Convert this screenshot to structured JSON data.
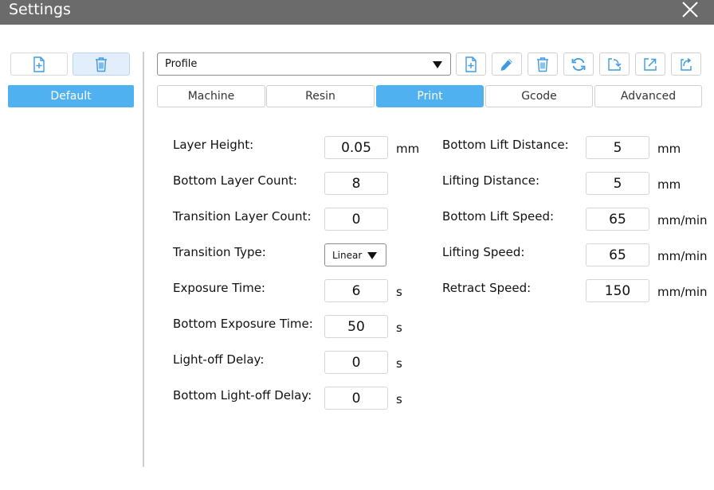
{
  "window": {
    "title": "Settings",
    "close_icon": "close-icon"
  },
  "sidebar": {
    "add_icon": "file-add-icon",
    "delete_icon": "trash-icon",
    "presets": [
      "Default"
    ]
  },
  "toolbar": {
    "profile_value": "Profile",
    "icons": [
      "file-add-icon",
      "pencil-icon",
      "trash-icon",
      "refresh-icon",
      "import-icon",
      "export-icon",
      "share-icon"
    ]
  },
  "tabs": [
    "Machine",
    "Resin",
    "Print",
    "Gcode",
    "Advanced"
  ],
  "active_tab": "Print",
  "colors": {
    "accent": "#4fb1ef",
    "titlebar": "#6b6b6b",
    "icon": "#3e9be0"
  },
  "left_fields": [
    {
      "label": "Layer Height:",
      "value": "0.05",
      "unit": "mm"
    },
    {
      "label": "Bottom Layer Count:",
      "value": "8",
      "unit": ""
    },
    {
      "label": "Transition Layer Count:",
      "value": "0",
      "unit": ""
    },
    {
      "label": "Transition Type:",
      "value": "Linear",
      "unit": ""
    },
    {
      "label": "Exposure Time:",
      "value": "6",
      "unit": "s"
    },
    {
      "label": "Bottom Exposure Time:",
      "value": "50",
      "unit": "s"
    },
    {
      "label": "Light-off Delay:",
      "value": "0",
      "unit": "s"
    },
    {
      "label": "Bottom Light-off Delay:",
      "value": "0",
      "unit": "s"
    }
  ],
  "right_fields": [
    {
      "label": "Bottom Lift Distance:",
      "value": "5",
      "unit": "mm"
    },
    {
      "label": "Lifting Distance:",
      "value": "5",
      "unit": "mm"
    },
    {
      "label": "Bottom Lift Speed:",
      "value": "65",
      "unit": "mm/min"
    },
    {
      "label": "Lifting Speed:",
      "value": "65",
      "unit": "mm/min"
    },
    {
      "label": "Retract Speed:",
      "value": "150",
      "unit": "mm/min"
    }
  ]
}
